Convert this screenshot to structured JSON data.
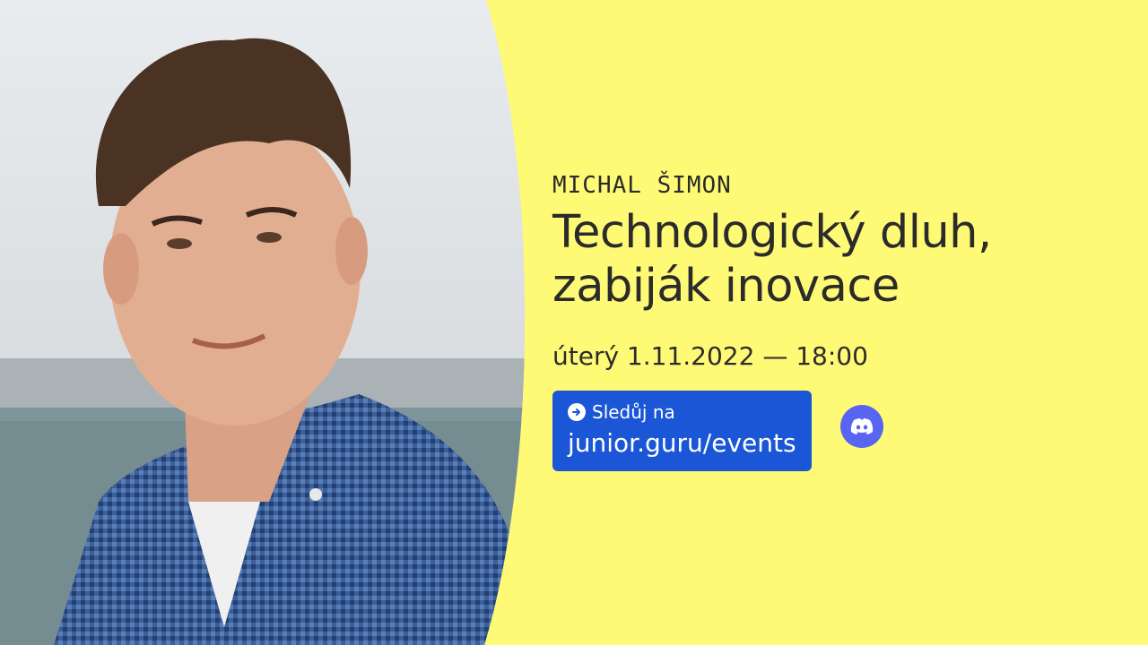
{
  "speaker": {
    "name": "MICHAL ŠIMON"
  },
  "event": {
    "title_line1": "Technologický dluh,",
    "title_line2": "zabiják inovace",
    "datetime": "úterý 1.11.2022 — 18:00"
  },
  "cta": {
    "label": "Sledůj na",
    "url": "junior.guru/events"
  },
  "icons": {
    "arrow": "arrow-right-circle-icon",
    "discord": "discord-icon"
  },
  "colors": {
    "background": "#fffa75",
    "cta": "#1a56d6",
    "discord": "#5865f2",
    "text": "#2b2b2b"
  }
}
